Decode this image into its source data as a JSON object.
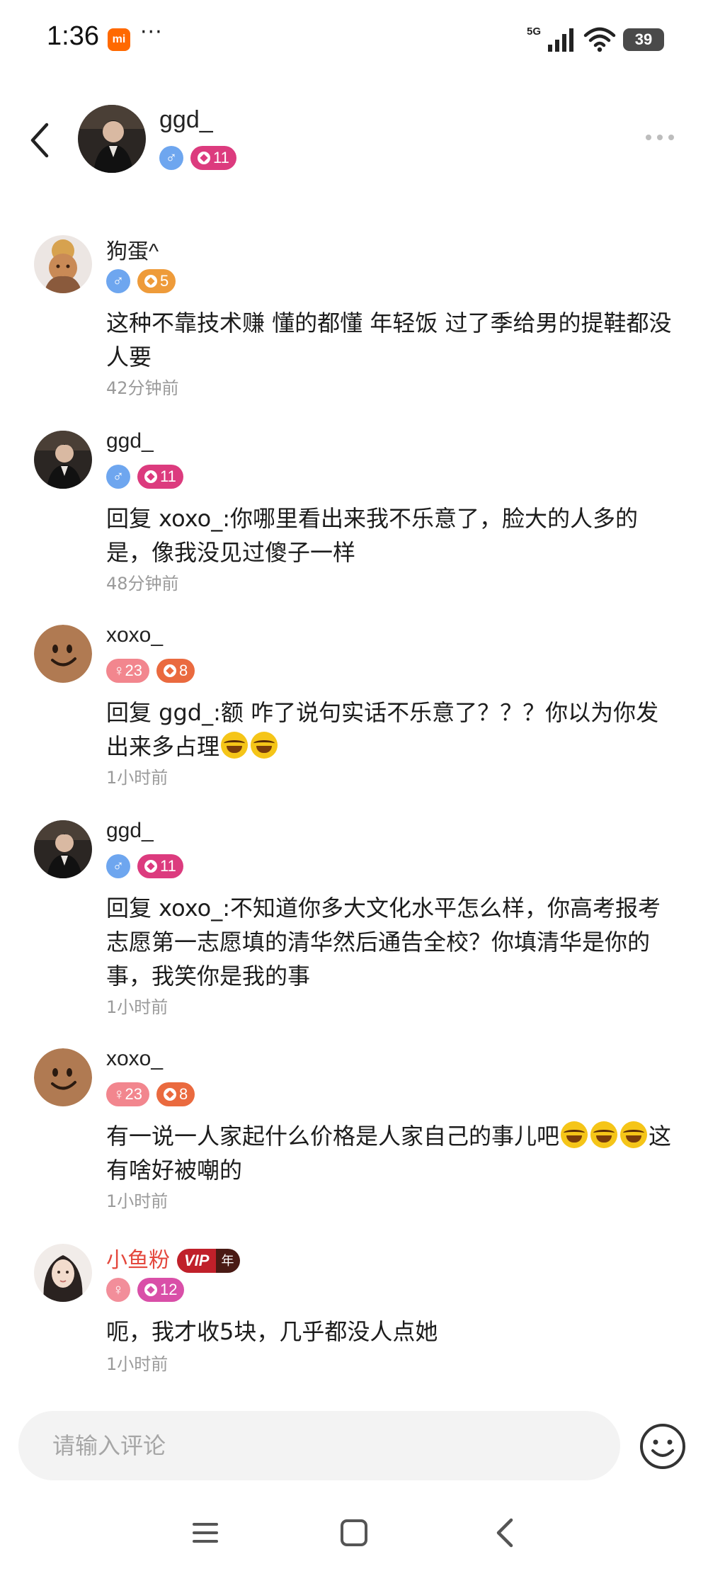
{
  "status_bar": {
    "time": "1:36",
    "mi_label": "mi",
    "dots": "···",
    "network": "5G",
    "battery": "39"
  },
  "header": {
    "name": "ggd_",
    "gender": "♂",
    "level": "11"
  },
  "comments": [
    {
      "name": "狗蛋^",
      "gender": "♂",
      "level": "5",
      "text": "这种不靠技术赚 懂的都懂 年轻饭 过了季给男的提鞋都没人要",
      "time": "42分钟前"
    },
    {
      "name": "ggd_",
      "gender": "♂",
      "level": "11",
      "text": "回复 xoxo_:你哪里看出来我不乐意了，脸大的人多的是，像我没见过傻子一样",
      "time": "48分钟前"
    },
    {
      "name": "xoxo_",
      "gender": "♀23",
      "level": "8",
      "text": "回复 ggd_:额 咋了说句实话不乐意了？？？你以为你发出来多占理",
      "time": "1小时前"
    },
    {
      "name": "ggd_",
      "gender": "♂",
      "level": "11",
      "text": "回复 xoxo_:不知道你多大文化水平怎么样，你高考报考志愿第一志愿填的清华然后通告全校？你填清华是你的事，我笑你是我的事",
      "time": "1小时前"
    },
    {
      "name": "xoxo_",
      "gender": "♀23",
      "level": "8",
      "text_a": "有一说一人家起什么价格是人家自己的事儿吧",
      "text_b": "这有啥好被嘲的",
      "time": "1小时前"
    },
    {
      "name": "小鱼粉",
      "vip": "VIP",
      "vip_period": "年",
      "gender": "♀",
      "level": "12",
      "text": "呃，我才收5块，几乎都没人点她",
      "time": "1小时前"
    }
  ],
  "input": {
    "placeholder": "请输入评论"
  },
  "colors": {
    "male_badge": "#6ea6ef",
    "female_badge": "#f2868e",
    "level_pink": "#dc3b7e",
    "level_orange": "#ee9b3a",
    "level_coral": "#ea6a3f",
    "vip_name": "#e4483d",
    "time_gray": "#9a9a9a"
  },
  "icons": {
    "back": "back-arrow-icon",
    "more": "more-dots-icon",
    "emoji": "emoji-smile-icon",
    "nav_menu": "menu-icon",
    "nav_home": "home-square-icon",
    "nav_back": "nav-back-icon"
  }
}
